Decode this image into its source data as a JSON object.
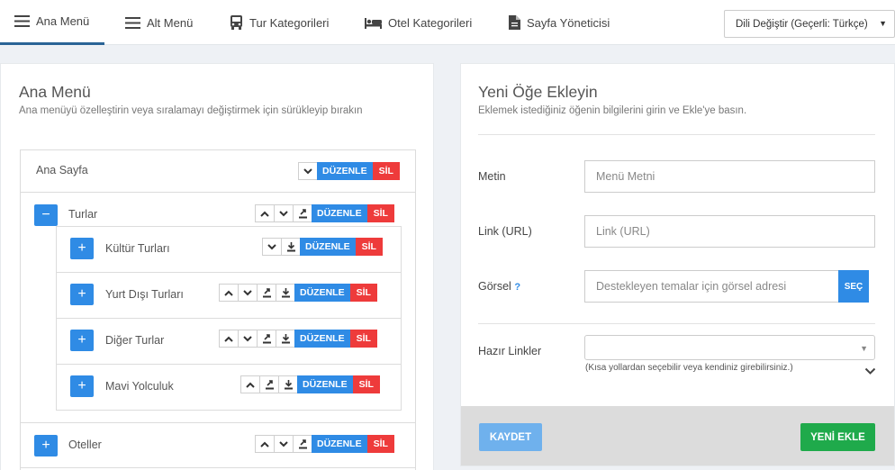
{
  "nav": {
    "tabs": [
      {
        "label": "Ana Menü",
        "icon": "menu-icon",
        "active": true
      },
      {
        "label": "Alt Menü",
        "icon": "menu-icon",
        "active": false
      },
      {
        "label": "Tur Kategorileri",
        "icon": "bus-icon",
        "active": false
      },
      {
        "label": "Otel Kategorileri",
        "icon": "bed-icon",
        "active": false
      },
      {
        "label": "Sayfa Yöneticisi",
        "icon": "document-icon",
        "active": false
      }
    ],
    "language_select": "Dili Değiştir (Geçerli: Türkçe)"
  },
  "left": {
    "title": "Ana Menü",
    "subtitle": "Ana menüyü özelleştirin veya sıralamayı değiştirmek için sürükleyip bırakın",
    "edit_label": "DÜZENLE",
    "delete_label": "SİL",
    "collapse_symbol": "−",
    "expand_symbol": "+",
    "items": [
      {
        "label": "Ana Sayfa",
        "controls": [
          "down"
        ]
      },
      {
        "label": "Turlar",
        "controls": [
          "up",
          "down",
          "move-out"
        ],
        "expanded": true,
        "children": [
          {
            "label": "Kültür Turları",
            "controls": [
              "down",
              "move-in"
            ]
          },
          {
            "label": "Yurt Dışı Turları",
            "controls": [
              "up",
              "down",
              "move-out",
              "move-in"
            ]
          },
          {
            "label": "Diğer Turlar",
            "controls": [
              "up",
              "down",
              "move-out",
              "move-in"
            ]
          },
          {
            "label": "Mavi Yolculuk",
            "controls": [
              "up",
              "move-out",
              "move-in"
            ]
          }
        ]
      },
      {
        "label": "Oteller",
        "controls": [
          "up",
          "down",
          "move-out"
        ],
        "expanded": false
      }
    ]
  },
  "right": {
    "title": "Yeni Öğe Ekleyin",
    "subtitle": "Eklemek istediğiniz öğenin bilgilerini girin ve Ekle'ye basın.",
    "fields": {
      "text_label": "Metin",
      "text_placeholder": "Menü Metni",
      "link_label": "Link (URL)",
      "link_placeholder": "Link (URL)",
      "image_label": "Görsel",
      "image_help": "?",
      "image_placeholder": "Destekleyen temalar için görsel adresi",
      "image_button": "SEÇ",
      "quick_label": "Hazır Linkler",
      "quick_hint": "(Kısa yollardan seçebilir veya kendiniz girebilirsiniz.)"
    },
    "save_button": "KAYDET",
    "add_button": "YENİ EKLE"
  },
  "colors": {
    "primary": "#2f8be5",
    "danger": "#ee3b3b",
    "success": "#1faa4b",
    "save_disabled": "#6fb1ed"
  }
}
